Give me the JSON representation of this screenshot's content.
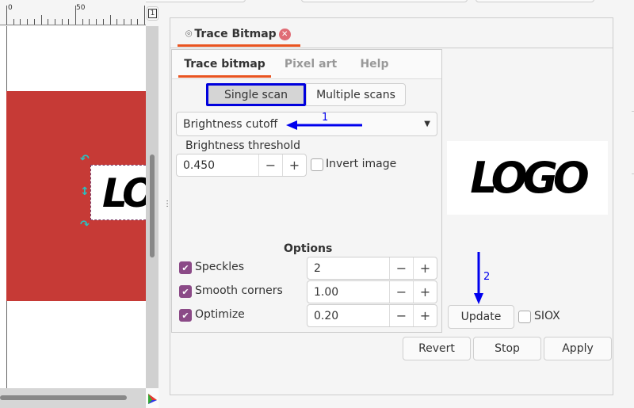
{
  "ruler": {
    "labels": [
      "0",
      "50"
    ]
  },
  "canvas": {
    "page_indicator": "1",
    "selected_object_text": "LOG"
  },
  "dock": {
    "tab_label": "Trace Bitmap",
    "tabs": [
      {
        "label": "Trace bitmap",
        "active": true
      },
      {
        "label": "Pixel art"
      },
      {
        "label": "Help"
      }
    ],
    "scan_modes": {
      "single": "Single scan",
      "multiple": "Multiple scans",
      "selected": "Single scan"
    },
    "mode_select": {
      "value": "Brightness cutoff"
    },
    "threshold": {
      "label": "Brightness threshold",
      "value": "0.450"
    },
    "invert": {
      "label": "Invert image",
      "checked": false
    },
    "options": {
      "title": "Options",
      "rows": [
        {
          "label": "Speckles",
          "checked": true,
          "value": "2"
        },
        {
          "label": "Smooth corners",
          "checked": true,
          "value": "1.00"
        },
        {
          "label": "Optimize",
          "checked": true,
          "value": "0.20"
        }
      ]
    },
    "preview_text": "LOGO",
    "update_label": "Update",
    "siox": {
      "label": "SIOX",
      "checked": false
    },
    "buttons": {
      "revert": "Revert",
      "stop": "Stop",
      "apply": "Apply"
    }
  },
  "annotations": {
    "arrow1": "1",
    "arrow2": "2",
    "color": "#0000ee"
  },
  "colors": {
    "accent": "#e95420",
    "highlight_border": "#0000dd",
    "checkbox": "#8b4a87",
    "canvas_rect": "#c63a36"
  }
}
